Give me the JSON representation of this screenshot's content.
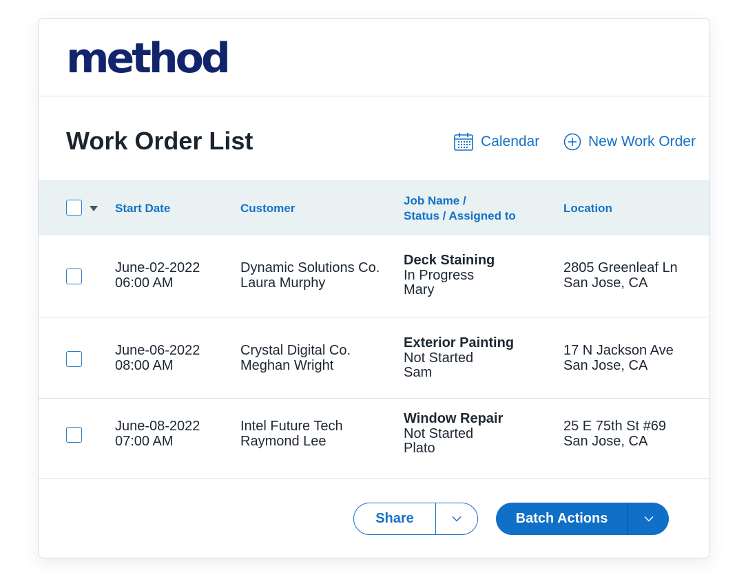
{
  "brand": {
    "logo_text": "method",
    "color": "#12246b"
  },
  "header": {
    "title": "Work Order List",
    "actions": [
      {
        "label": "Calendar",
        "icon": "calendar-icon"
      },
      {
        "label": "New Work Order",
        "icon": "plus-circle-icon"
      }
    ]
  },
  "table": {
    "columns": [
      "Start Date",
      "Customer",
      "Job Name /",
      "Status / Assigned to",
      "Location"
    ],
    "rows": [
      {
        "date": "June-02-2022",
        "time": "06:00 AM",
        "customer": "Dynamic Solutions Co.",
        "contact": "Laura Murphy",
        "job": "Deck Staining",
        "status": "In Progress",
        "assignee": "Mary",
        "address": "2805 Greenleaf Ln",
        "city": "San Jose, CA"
      },
      {
        "date": "June-06-2022",
        "time": "08:00 AM",
        "customer": "Crystal Digital Co.",
        "contact": "Meghan Wright",
        "job": "Exterior Painting",
        "status": "Not Started",
        "assignee": "Sam",
        "address": "17 N Jackson Ave",
        "city": "San Jose, CA"
      },
      {
        "date": "June-08-2022",
        "time": "07:00 AM",
        "customer": "Intel Future Tech",
        "contact": "Raymond Lee",
        "job": "Window Repair",
        "status": "Not Started",
        "assignee": "Plato",
        "address": "25 E 75th St #69",
        "city": "San Jose, CA"
      }
    ]
  },
  "footer": {
    "share_label": "Share",
    "batch_label": "Batch Actions"
  },
  "colors": {
    "accent": "#1571c6",
    "header_bg": "#e9f1f3",
    "primary_button": "#1070c8",
    "text": "#1d2733"
  }
}
